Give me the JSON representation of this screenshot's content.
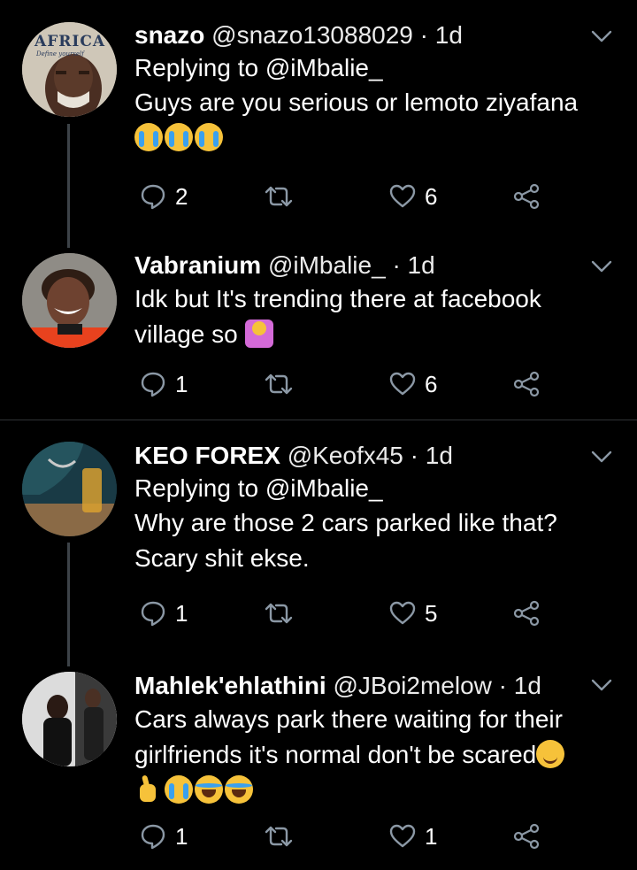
{
  "colors": {
    "background": "#000000",
    "text": "#ffffff",
    "icon": "#8b98a5",
    "divider": "#2f3336",
    "thread_line": "#3d4348"
  },
  "tweets": [
    {
      "name": "snazo",
      "handle": "@snazo13088029",
      "dot": "·",
      "time": "1d",
      "replying": "Replying to @iMbalie_",
      "text": "Guys are you serious or lemoto ziyafana",
      "emojis": [
        "crying-face",
        "crying-face",
        "crying-face"
      ],
      "avatar_text": "AFRICA",
      "avatar_subtext": "Define yourself",
      "reply_count": "2",
      "like_count": "6"
    },
    {
      "name": "Vabranium",
      "handle": "@iMbalie_",
      "dot": "·",
      "time": "1d",
      "text_line1": "Idk but It's trending there at facebook",
      "text_line2": "village  so",
      "emojis": [
        "shrugging-person"
      ],
      "reply_count": "1",
      "like_count": "6"
    },
    {
      "name": "KEO FOREX",
      "handle": "@Keofx45",
      "dot": "·",
      "time": "1d",
      "replying": "Replying to @iMbalie_",
      "text_line1": "Why are those 2 cars parked like that?",
      "text_line2": "Scary shit ekse.",
      "reply_count": "1",
      "like_count": "5"
    },
    {
      "name": "Mahlek'ehlathini",
      "handle": "@JBoi2melow",
      "dot": "·",
      "time": "1d",
      "text_line1": "Cars always park there waiting for their",
      "text_line2": "girlfriends it's normal don't be scared",
      "emojis_line2": [
        "smiling-face"
      ],
      "emojis_line3": [
        "crossed-fingers",
        "crying-face",
        "laughing-face",
        "laughing-face"
      ],
      "reply_count": "1",
      "like_count": "1"
    }
  ]
}
